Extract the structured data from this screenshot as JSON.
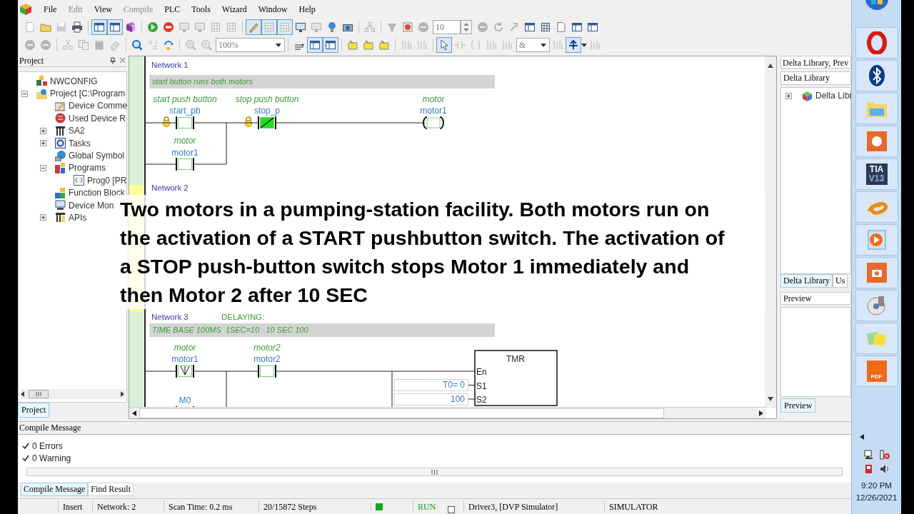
{
  "menu": [
    {
      "label": "File",
      "disabled": false
    },
    {
      "label": "Edit",
      "disabled": true
    },
    {
      "label": "View",
      "disabled": false
    },
    {
      "label": "Compile",
      "disabled": true
    },
    {
      "label": "PLC",
      "disabled": false
    },
    {
      "label": "Tools",
      "disabled": false
    },
    {
      "label": "Wizard",
      "disabled": false
    },
    {
      "label": "Window",
      "disabled": false
    },
    {
      "label": "Help",
      "disabled": false
    }
  ],
  "toolbar": {
    "step_value": "10",
    "zoom": "100%",
    "operator": "&"
  },
  "project_panel": {
    "title": "Project",
    "tree": [
      {
        "label": "NWCONFIG"
      },
      {
        "label": "Project [C:\\Program",
        "expanded": true,
        "children": [
          {
            "label": "Device Comme"
          },
          {
            "label": "Used Device R"
          },
          {
            "label": "SA2",
            "expanded": false
          },
          {
            "label": "Tasks",
            "expanded": false
          },
          {
            "label": "Global Symbol"
          },
          {
            "label": "Programs",
            "expanded": true,
            "children": [
              {
                "label": "Prog0 [PR"
              }
            ]
          },
          {
            "label": "Function Block"
          },
          {
            "label": "Device Mon"
          },
          {
            "label": "APIs",
            "expanded": false
          }
        ]
      }
    ],
    "tab": "Project"
  },
  "editor": {
    "networks": [
      {
        "label": "Network 1",
        "comment": "start button runs both motors",
        "elements": [
          {
            "kind": "contact",
            "comment": "start push button",
            "variable": "start_pb",
            "forced": true,
            "energized": false
          },
          {
            "kind": "contact_nc",
            "comment": "stop push button",
            "variable": "stop_p",
            "forced": true,
            "energized": true
          },
          {
            "kind": "coil",
            "comment": "motor",
            "variable": "motor1",
            "energized": false
          }
        ],
        "branch": {
          "kind": "contact",
          "comment": "motor",
          "variable": "motor1",
          "energized": false
        }
      },
      {
        "label": "Network 2"
      },
      {
        "label": "Network 3",
        "note": "DELAYING:",
        "comment": "TIME BASE 100MS  1SEC=10   10 SEC 100",
        "elements": [
          {
            "kind": "contact_falling",
            "comment": "motor",
            "variable": "motor1",
            "energized": false
          },
          {
            "kind": "contact",
            "comment": "motor2",
            "variable": "motor2",
            "energized": false
          },
          {
            "kind": "timer",
            "title": "TMR",
            "pins": [
              "En",
              "S1",
              "S2"
            ],
            "inputs": [
              "T0= 0",
              "100"
            ]
          }
        ],
        "branch": {
          "kind": "contact",
          "variable": "M0"
        }
      }
    ]
  },
  "caption": "Two motors in a pumping-station facility. Both motors run on the activation of a START pushbutton switch. The activation of a STOP push-button switch stops Motor 1 immediately and then Motor 2 after 10 SEC",
  "library_panel": {
    "title": "Delta Library, Prev",
    "selector": "Delta Library",
    "tree": [
      {
        "label": "Delta Libr",
        "expanded": false
      }
    ],
    "tabs": [
      {
        "label": "Delta Library",
        "selected": true
      },
      {
        "label": "Us",
        "selected": false
      }
    ],
    "preview_title": "Preview",
    "preview_tab": "Preview"
  },
  "compile_panel": {
    "title": "Compile Message",
    "messages": [
      "0 Errors",
      "0 Warning"
    ],
    "tabs": [
      {
        "label": "Compile Message",
        "selected": true
      },
      {
        "label": "Find Result",
        "selected": false
      }
    ]
  },
  "status_bar": {
    "mode": "Insert",
    "network": "Network: 2",
    "scan_time": "Scan Time: 0.2 ms",
    "steps": "20/15872 Steps",
    "running": true,
    "run_state": "RUN",
    "driver": "Driver3, [DVP Simulator]",
    "device": "SIMULATOR"
  },
  "taskbar": {
    "apps": [
      {
        "kind": "start"
      },
      {
        "kind": "ring"
      },
      {
        "kind": "bluetooth"
      },
      {
        "kind": "folder"
      },
      {
        "kind": "record"
      },
      {
        "kind": "tia",
        "label": "TIA",
        "sublabel": "V13"
      },
      {
        "kind": "swirl"
      },
      {
        "kind": "play"
      },
      {
        "kind": "camera"
      },
      {
        "kind": "disc"
      },
      {
        "kind": "notes"
      },
      {
        "kind": "pdf",
        "label": "PDF"
      }
    ],
    "time": "9:20 PM",
    "date": "12/26/2021"
  }
}
